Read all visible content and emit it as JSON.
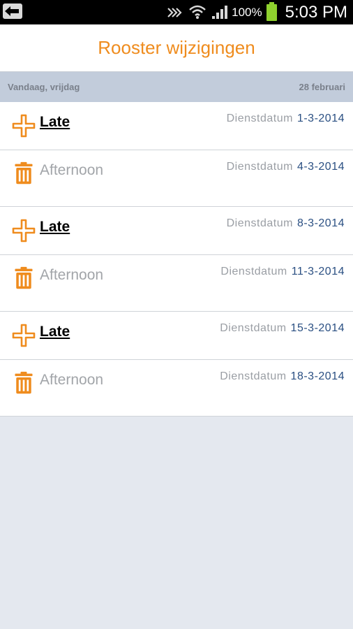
{
  "statusbar": {
    "battery_percent": "100%",
    "time": "5:03 PM"
  },
  "header": {
    "title": "Rooster wijzigingen"
  },
  "datebar": {
    "left": "Vandaag, vrijdag",
    "right": "28 februari"
  },
  "colors": {
    "accent": "#ef8c1e",
    "date_blue": "#2a4f82"
  },
  "rows": [
    {
      "type": "add",
      "icon": "plus-icon",
      "name": "Late",
      "label": "Dienstdatum",
      "date": "1-3-2014"
    },
    {
      "type": "delete",
      "icon": "trash-icon",
      "name": "Afternoon",
      "label": "Dienstdatum",
      "date": "4-3-2014"
    },
    {
      "type": "add",
      "icon": "plus-icon",
      "name": "Late",
      "label": "Dienstdatum",
      "date": "8-3-2014"
    },
    {
      "type": "delete",
      "icon": "trash-icon",
      "name": "Afternoon",
      "label": "Dienstdatum",
      "date": "11-3-2014"
    },
    {
      "type": "add",
      "icon": "plus-icon",
      "name": "Late",
      "label": "Dienstdatum",
      "date": "15-3-2014"
    },
    {
      "type": "delete",
      "icon": "trash-icon",
      "name": "Afternoon",
      "label": "Dienstdatum",
      "date": "18-3-2014"
    }
  ]
}
